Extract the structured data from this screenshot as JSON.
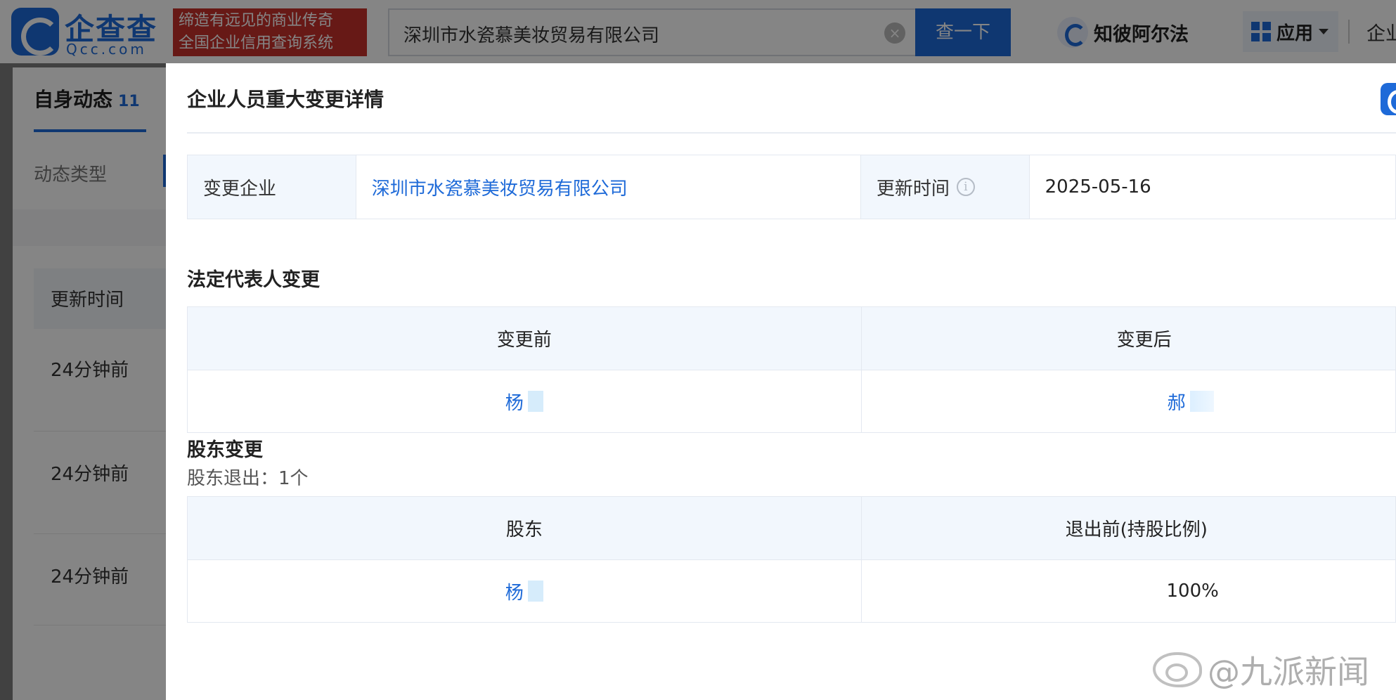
{
  "header": {
    "logo_text": "企查查",
    "logo_sub": "Qcc.com",
    "slogan_line1": "缔造有远见的商业传奇",
    "slogan_line2": "全国企业信用查询系统",
    "search_value": "深圳市水瓷慕美妆贸易有限公司",
    "search_button": "查一下",
    "zhibi_label": "知彼阿尔法",
    "apps_label": "应用",
    "more_label": "企业"
  },
  "background": {
    "tab_label": "自身动态",
    "tab_count": "11",
    "filter_label": "动态类型",
    "column_header": "更新时间",
    "rows": [
      "24分钟前",
      "24分钟前",
      "24分钟前"
    ]
  },
  "modal": {
    "title": "企业人员重大变更详情",
    "info": {
      "company_label": "变更企业",
      "company_value": "深圳市水瓷慕美妆贸易有限公司",
      "update_label": "更新时间",
      "update_info_icon": "i",
      "update_value": "2025-05-16"
    },
    "legal_rep": {
      "title": "法定代表人变更",
      "before_header": "变更前",
      "after_header": "变更后",
      "before_value": "杨",
      "after_value": "郝"
    },
    "shareholder": {
      "title": "股东变更",
      "exit_count": "股东退出：1个",
      "holder_header": "股东",
      "ratio_header": "退出前(持股比例)",
      "holder_value": "杨",
      "ratio_value": "100%"
    }
  },
  "watermark": "@九派新闻",
  "colors": {
    "brand_blue": "#1e6ad8",
    "slogan_red": "#c6302b",
    "table_head_bg": "#f2f7fd"
  },
  "icons": {
    "logo": "qcc-logo-icon",
    "clear": "clear-icon",
    "zhibi": "zhibi-logo-icon",
    "apps": "apps-grid-icon",
    "caret": "chevron-down-icon",
    "info": "info-icon"
  }
}
